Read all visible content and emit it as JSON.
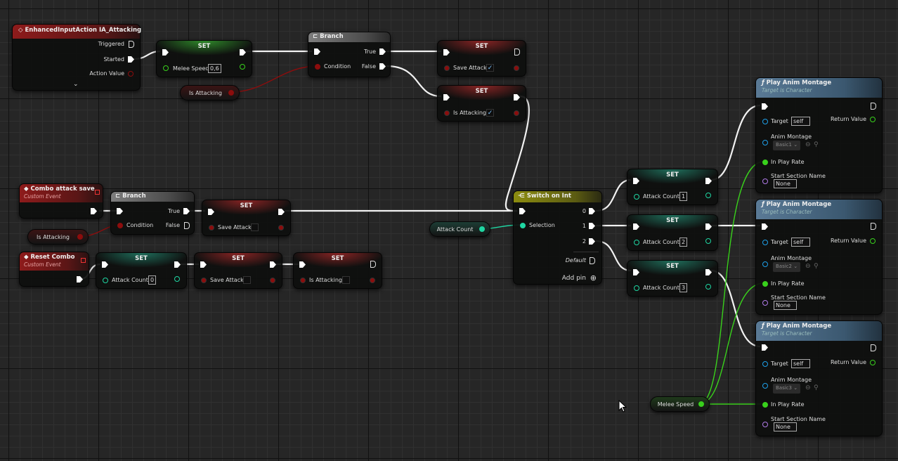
{
  "colors": {
    "exec": "#ffffff",
    "bool": "#8c0d0d",
    "float": "#39d11c",
    "int": "#1fd6a2",
    "object": "#1e9fe8",
    "name": "#b07ae8",
    "event_header": "#8e1b1b",
    "branch_header": "#7d7d7d",
    "switch_header": "#8c8c10",
    "function_header": "#5a7a96"
  },
  "ia_event": {
    "title": "EnhancedInputAction IA_Attacking",
    "triggered": "Triggered",
    "started": "Started",
    "action_value": "Action Value",
    "icon": "event-diamond-icon",
    "expand_icon": "chevron-down-icon"
  },
  "set_melee": {
    "title": "SET",
    "var": "Melee Speed",
    "value": "0,6"
  },
  "get_is_attacking_1": {
    "label": "Is Attacking"
  },
  "branch_1": {
    "title": "Branch",
    "true": "True",
    "false": "False",
    "condition": "Condition"
  },
  "set_save_attack_1": {
    "title": "SET",
    "var": "Save Attack",
    "checked": true,
    "check": "✓"
  },
  "set_is_attacking_1": {
    "title": "SET",
    "var": "Is Attacking",
    "checked": true,
    "check": "✓"
  },
  "combo_event": {
    "title": "Combo attack save",
    "subtitle": "Custom Event"
  },
  "branch_2": {
    "title": "Branch",
    "true": "True",
    "false": "False",
    "condition": "Condition"
  },
  "set_save_attack_2": {
    "title": "SET",
    "var": "Save Attack",
    "checked": false
  },
  "get_is_attacking_2": {
    "label": "Is Attacking"
  },
  "reset_event": {
    "title": "Reset Combo",
    "subtitle": "Custom Event"
  },
  "set_attack_count_0": {
    "title": "SET",
    "var": "Attack Count",
    "value": "0"
  },
  "set_save_attack_3": {
    "title": "SET",
    "var": "Save Attack",
    "checked": false
  },
  "set_is_attacking_3": {
    "title": "SET",
    "var": "Is Attacking",
    "checked": false
  },
  "get_attack_count": {
    "label": "Attack Count"
  },
  "switch": {
    "title": "Switch on Int",
    "selection": "Selection",
    "out0": "0",
    "out1": "1",
    "out2": "2",
    "default": "Default",
    "add_pin": "Add pin"
  },
  "set_attack_count": [
    {
      "title": "SET",
      "var": "Attack Count",
      "value": "1"
    },
    {
      "title": "SET",
      "var": "Attack Count",
      "value": "2"
    },
    {
      "title": "SET",
      "var": "Attack Count",
      "value": "3"
    }
  ],
  "montages": [
    {
      "title": "Play Anim Montage",
      "subtitle": "Target is Character",
      "target": "Target",
      "target_value": "self",
      "return": "Return Value",
      "anim": "Anim Montage",
      "anim_value": "Basic1",
      "rate": "In Play Rate",
      "section": "Start Section Name",
      "section_value": "None"
    },
    {
      "title": "Play Anim Montage",
      "subtitle": "Target is Character",
      "target": "Target",
      "target_value": "self",
      "return": "Return Value",
      "anim": "Anim Montage",
      "anim_value": "Basic2",
      "rate": "In Play Rate",
      "section": "Start Section Name",
      "section_value": "None"
    },
    {
      "title": "Play Anim Montage",
      "subtitle": "Target is Character",
      "target": "Target",
      "target_value": "self",
      "return": "Return Value",
      "anim": "Anim Montage",
      "anim_value": "Basic3",
      "rate": "In Play Rate",
      "section": "Start Section Name",
      "section_value": "None"
    }
  ],
  "get_melee_speed": {
    "label": "Melee Speed"
  }
}
